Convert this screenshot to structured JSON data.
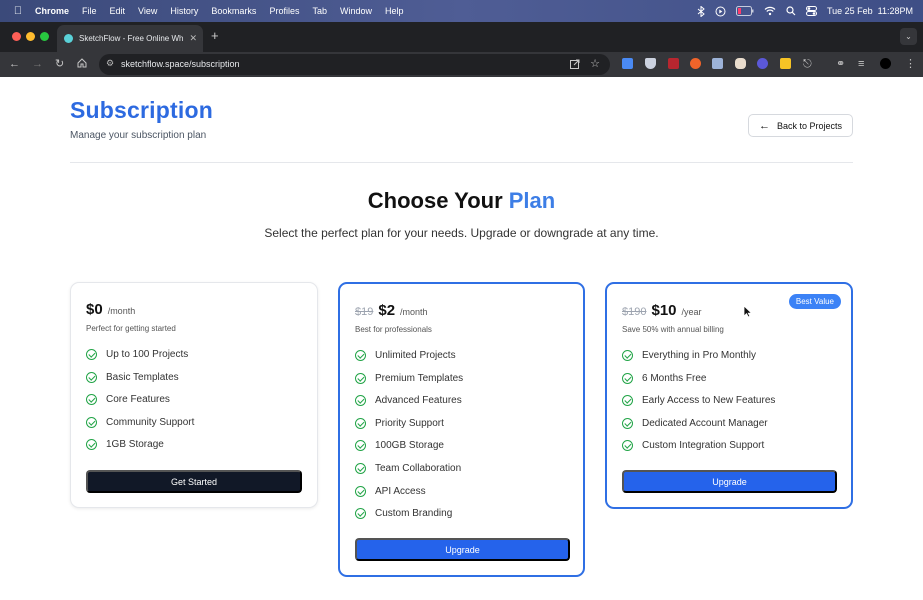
{
  "menubar": {
    "app": "Chrome",
    "items": [
      "File",
      "Edit",
      "View",
      "History",
      "Bookmarks",
      "Profiles",
      "Tab",
      "Window",
      "Help"
    ],
    "clock": "Tue 25 Feb  11:28PM"
  },
  "browser": {
    "tab_title": "SketchFlow - Free Online Wh",
    "url": "sketchflow.space/subscription"
  },
  "page": {
    "title": "Subscription",
    "subtitle": "Manage your subscription plan",
    "back_label": "Back to Projects",
    "heading_prefix": "Choose Your ",
    "heading_highlight": "Plan",
    "lead": "Select the perfect plan for your needs. Upgrade or downgrade at any time."
  },
  "plans": [
    {
      "price": "$0",
      "period": "/month",
      "description": "Perfect for getting started",
      "features": [
        "Up to 100 Projects",
        "Basic Templates",
        "Core Features",
        "Community Support",
        "1GB Storage"
      ],
      "button": "Get Started"
    },
    {
      "old_price": "$19",
      "price": "$2",
      "period": "/month",
      "description": "Best for professionals",
      "features": [
        "Unlimited Projects",
        "Premium Templates",
        "Advanced Features",
        "Priority Support",
        "100GB Storage",
        "Team Collaboration",
        "API Access",
        "Custom Branding"
      ],
      "button": "Upgrade"
    },
    {
      "old_price": "$190",
      "price": "$10",
      "period": "/year",
      "description": "Save 50% with annual billing",
      "badge": "Best Value",
      "features": [
        "Everything in Pro Monthly",
        "6 Months Free",
        "Early Access to New Features",
        "Dedicated Account Manager",
        "Custom Integration Support"
      ],
      "button": "Upgrade"
    }
  ],
  "colors": {
    "accent": "#2563eb",
    "title_blue": "#2d6ae0",
    "check_green": "#22a447",
    "dark_button": "#111827"
  }
}
